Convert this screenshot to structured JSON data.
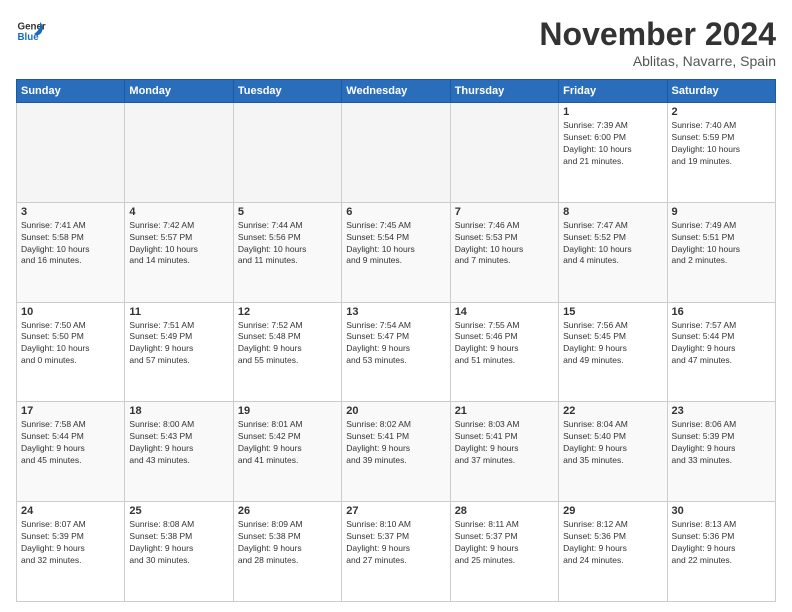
{
  "logo": {
    "line1": "General",
    "line2": "Blue"
  },
  "title": "November 2024",
  "location": "Ablitas, Navarre, Spain",
  "days_of_week": [
    "Sunday",
    "Monday",
    "Tuesday",
    "Wednesday",
    "Thursday",
    "Friday",
    "Saturday"
  ],
  "weeks": [
    [
      {
        "day": "",
        "info": ""
      },
      {
        "day": "",
        "info": ""
      },
      {
        "day": "",
        "info": ""
      },
      {
        "day": "",
        "info": ""
      },
      {
        "day": "",
        "info": ""
      },
      {
        "day": "1",
        "info": "Sunrise: 7:39 AM\nSunset: 6:00 PM\nDaylight: 10 hours\nand 21 minutes."
      },
      {
        "day": "2",
        "info": "Sunrise: 7:40 AM\nSunset: 5:59 PM\nDaylight: 10 hours\nand 19 minutes."
      }
    ],
    [
      {
        "day": "3",
        "info": "Sunrise: 7:41 AM\nSunset: 5:58 PM\nDaylight: 10 hours\nand 16 minutes."
      },
      {
        "day": "4",
        "info": "Sunrise: 7:42 AM\nSunset: 5:57 PM\nDaylight: 10 hours\nand 14 minutes."
      },
      {
        "day": "5",
        "info": "Sunrise: 7:44 AM\nSunset: 5:56 PM\nDaylight: 10 hours\nand 11 minutes."
      },
      {
        "day": "6",
        "info": "Sunrise: 7:45 AM\nSunset: 5:54 PM\nDaylight: 10 hours\nand 9 minutes."
      },
      {
        "day": "7",
        "info": "Sunrise: 7:46 AM\nSunset: 5:53 PM\nDaylight: 10 hours\nand 7 minutes."
      },
      {
        "day": "8",
        "info": "Sunrise: 7:47 AM\nSunset: 5:52 PM\nDaylight: 10 hours\nand 4 minutes."
      },
      {
        "day": "9",
        "info": "Sunrise: 7:49 AM\nSunset: 5:51 PM\nDaylight: 10 hours\nand 2 minutes."
      }
    ],
    [
      {
        "day": "10",
        "info": "Sunrise: 7:50 AM\nSunset: 5:50 PM\nDaylight: 10 hours\nand 0 minutes."
      },
      {
        "day": "11",
        "info": "Sunrise: 7:51 AM\nSunset: 5:49 PM\nDaylight: 9 hours\nand 57 minutes."
      },
      {
        "day": "12",
        "info": "Sunrise: 7:52 AM\nSunset: 5:48 PM\nDaylight: 9 hours\nand 55 minutes."
      },
      {
        "day": "13",
        "info": "Sunrise: 7:54 AM\nSunset: 5:47 PM\nDaylight: 9 hours\nand 53 minutes."
      },
      {
        "day": "14",
        "info": "Sunrise: 7:55 AM\nSunset: 5:46 PM\nDaylight: 9 hours\nand 51 minutes."
      },
      {
        "day": "15",
        "info": "Sunrise: 7:56 AM\nSunset: 5:45 PM\nDaylight: 9 hours\nand 49 minutes."
      },
      {
        "day": "16",
        "info": "Sunrise: 7:57 AM\nSunset: 5:44 PM\nDaylight: 9 hours\nand 47 minutes."
      }
    ],
    [
      {
        "day": "17",
        "info": "Sunrise: 7:58 AM\nSunset: 5:44 PM\nDaylight: 9 hours\nand 45 minutes."
      },
      {
        "day": "18",
        "info": "Sunrise: 8:00 AM\nSunset: 5:43 PM\nDaylight: 9 hours\nand 43 minutes."
      },
      {
        "day": "19",
        "info": "Sunrise: 8:01 AM\nSunset: 5:42 PM\nDaylight: 9 hours\nand 41 minutes."
      },
      {
        "day": "20",
        "info": "Sunrise: 8:02 AM\nSunset: 5:41 PM\nDaylight: 9 hours\nand 39 minutes."
      },
      {
        "day": "21",
        "info": "Sunrise: 8:03 AM\nSunset: 5:41 PM\nDaylight: 9 hours\nand 37 minutes."
      },
      {
        "day": "22",
        "info": "Sunrise: 8:04 AM\nSunset: 5:40 PM\nDaylight: 9 hours\nand 35 minutes."
      },
      {
        "day": "23",
        "info": "Sunrise: 8:06 AM\nSunset: 5:39 PM\nDaylight: 9 hours\nand 33 minutes."
      }
    ],
    [
      {
        "day": "24",
        "info": "Sunrise: 8:07 AM\nSunset: 5:39 PM\nDaylight: 9 hours\nand 32 minutes."
      },
      {
        "day": "25",
        "info": "Sunrise: 8:08 AM\nSunset: 5:38 PM\nDaylight: 9 hours\nand 30 minutes."
      },
      {
        "day": "26",
        "info": "Sunrise: 8:09 AM\nSunset: 5:38 PM\nDaylight: 9 hours\nand 28 minutes."
      },
      {
        "day": "27",
        "info": "Sunrise: 8:10 AM\nSunset: 5:37 PM\nDaylight: 9 hours\nand 27 minutes."
      },
      {
        "day": "28",
        "info": "Sunrise: 8:11 AM\nSunset: 5:37 PM\nDaylight: 9 hours\nand 25 minutes."
      },
      {
        "day": "29",
        "info": "Sunrise: 8:12 AM\nSunset: 5:36 PM\nDaylight: 9 hours\nand 24 minutes."
      },
      {
        "day": "30",
        "info": "Sunrise: 8:13 AM\nSunset: 5:36 PM\nDaylight: 9 hours\nand 22 minutes."
      }
    ]
  ]
}
